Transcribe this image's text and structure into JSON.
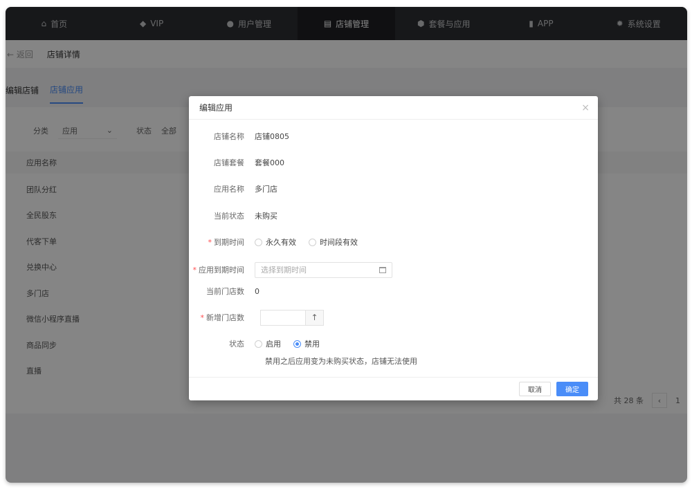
{
  "nav": {
    "items": [
      {
        "icon": "home-icon",
        "glyph": "⌂",
        "label": "首页"
      },
      {
        "icon": "diamond-icon",
        "glyph": "◆",
        "label": "VIP"
      },
      {
        "icon": "users-icon",
        "glyph": "●",
        "label": "用户管理"
      },
      {
        "icon": "store-icon",
        "glyph": "▤",
        "label": "店铺管理"
      },
      {
        "icon": "package-icon",
        "glyph": "⬢",
        "label": "套餐与应用"
      },
      {
        "icon": "phone-icon",
        "glyph": "▮",
        "label": "APP"
      },
      {
        "icon": "gear-icon",
        "glyph": "✹",
        "label": "系统设置"
      }
    ],
    "active_index": 3
  },
  "breadcrumb": {
    "back": "← 返回",
    "title": "店铺详情"
  },
  "tabs": [
    {
      "label": "编辑店铺"
    },
    {
      "label": "店铺应用"
    }
  ],
  "filters": {
    "category_label": "分类",
    "category_value": "应用",
    "status_label": "状态",
    "status_value": "全部"
  },
  "table": {
    "header": "应用名称",
    "rows": [
      "团队分红",
      "全民股东",
      "代客下单",
      "兑换中心",
      "多门店",
      "微信小程序直播",
      "商品同步",
      "直播"
    ]
  },
  "pager": {
    "total": "共 28 条",
    "prev": "‹",
    "page": "1"
  },
  "modal": {
    "title": "编辑应用",
    "close": "×",
    "fields": {
      "store_name_label": "店铺名称",
      "store_name_value": "店铺0805",
      "package_label": "店铺套餐",
      "package_value": "套餐000",
      "app_name_label": "应用名称",
      "app_name_value": "多门店",
      "status_now_label": "当前状态",
      "status_now_value": "未购买",
      "expire_label": "到期时间",
      "expire_opt1": "永久有效",
      "expire_opt2": "时间段有效",
      "app_expire_label": "应用到期时间",
      "app_expire_placeholder": "选择到期时间",
      "store_count_label": "当前门店数",
      "store_count_value": "0",
      "new_store_label": "新增门店数",
      "step_up": "↑",
      "state_label": "状态",
      "state_opt1": "启用",
      "state_opt2": "禁用",
      "hint": "禁用之后应用变为未购买状态，店铺无法使用"
    },
    "cancel": "取消",
    "ok": "确定"
  },
  "colors": {
    "accent": "#4a8df8",
    "required": "#ff4d4f",
    "nav_bg": "#2d2f33"
  }
}
